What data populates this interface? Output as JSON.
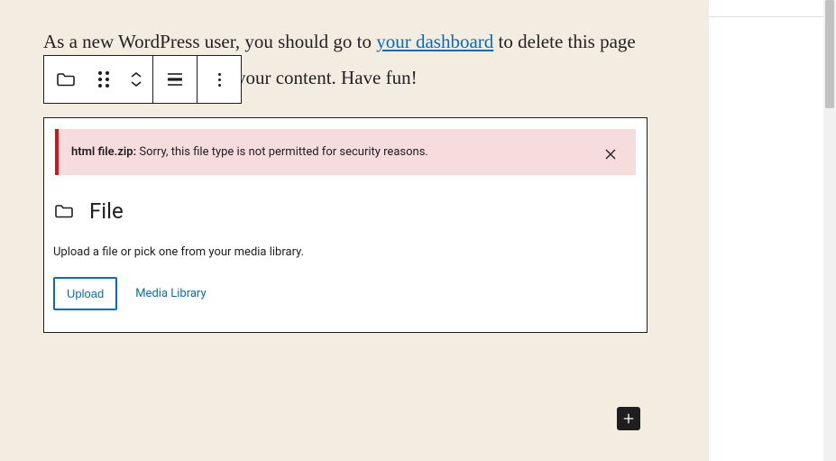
{
  "paragraph": {
    "part1": "As a new WordPress user, you should go to ",
    "link_text": "your dashboard",
    "part2": " to delete this page and create new pages for your content. Have fun!"
  },
  "toolbar": {
    "block_type": "File",
    "drag": "Drag",
    "move_up": "Move up",
    "move_down": "Move down",
    "align": "Align",
    "more": "Options"
  },
  "file_block": {
    "error_filename": "html file.zip:",
    "error_message": " Sorry, this file type is not permitted for security reasons.",
    "close": "Dismiss",
    "title": "File",
    "description": "Upload a file or pick one from your media library.",
    "upload_label": "Upload",
    "media_library_label": "Media Library"
  },
  "add_block": "Add block"
}
